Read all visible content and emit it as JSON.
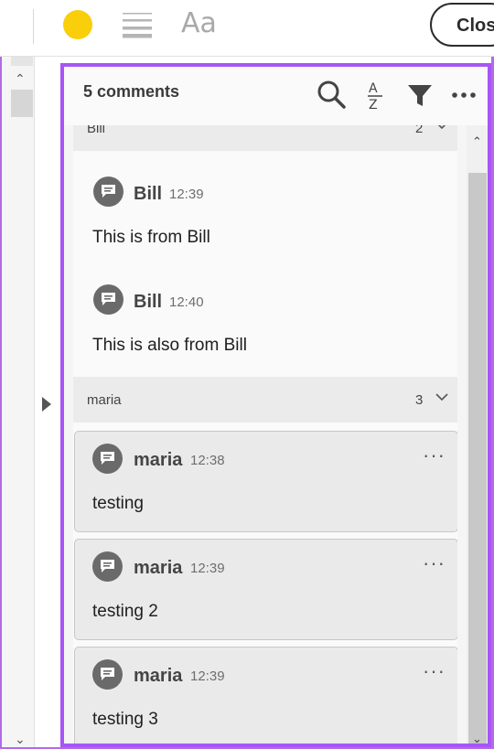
{
  "toolbar": {
    "color_swatch": "#f9ce0a",
    "font_label": "Aa",
    "close_label": "Close"
  },
  "panel": {
    "count_label": "5 comments",
    "icons": [
      "search-icon",
      "sort-az-icon",
      "filter-icon",
      "more-options-icon"
    ]
  },
  "groups": [
    {
      "name": "Bill",
      "count": "2",
      "comments": [
        {
          "author": "Bill",
          "time": "12:39",
          "text": "This is from Bill"
        },
        {
          "author": "Bill",
          "time": "12:40",
          "text": "This is also from Bill"
        }
      ]
    },
    {
      "name": "maria",
      "count": "3",
      "comments": [
        {
          "author": "maria",
          "time": "12:38",
          "text": "testing"
        },
        {
          "author": "maria",
          "time": "12:39",
          "text": "testing 2"
        },
        {
          "author": "maria",
          "time": "12:39",
          "text": "testing 3"
        }
      ]
    }
  ],
  "colors": {
    "accent_border": "#a855f7",
    "avatar_bg": "#6a6a6a"
  }
}
